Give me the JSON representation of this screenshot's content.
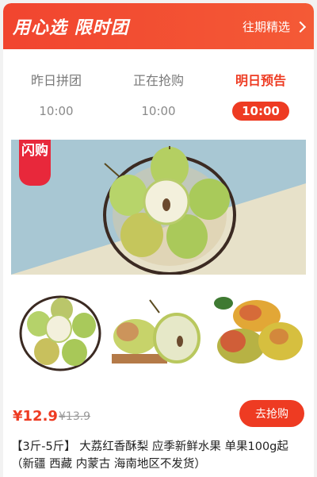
{
  "header": {
    "brand": "用心选 限时团",
    "past_link": "往期精选"
  },
  "tabs": [
    {
      "label": "昨日拼团",
      "time": "10:00",
      "active": false
    },
    {
      "label": "正在抢购",
      "time": "10:00",
      "active": false
    },
    {
      "label": "明日预告",
      "time": "10:00",
      "active": true
    }
  ],
  "banner": {
    "badge": "闪购",
    "colors": {
      "top": "#a8c7d3",
      "bottom": "#e7e1c9"
    }
  },
  "product": {
    "price_now": "¥12.9",
    "price_old": "¥13.9",
    "buy_label": "去抢购",
    "title": "【3斤-5斤】 大荔红香酥梨 应季新鲜水果 单果100g起（新疆 西藏 内蒙古 海南地区不发货）"
  },
  "colors": {
    "accent": "#ee3b22",
    "badge": "#e8283b"
  }
}
